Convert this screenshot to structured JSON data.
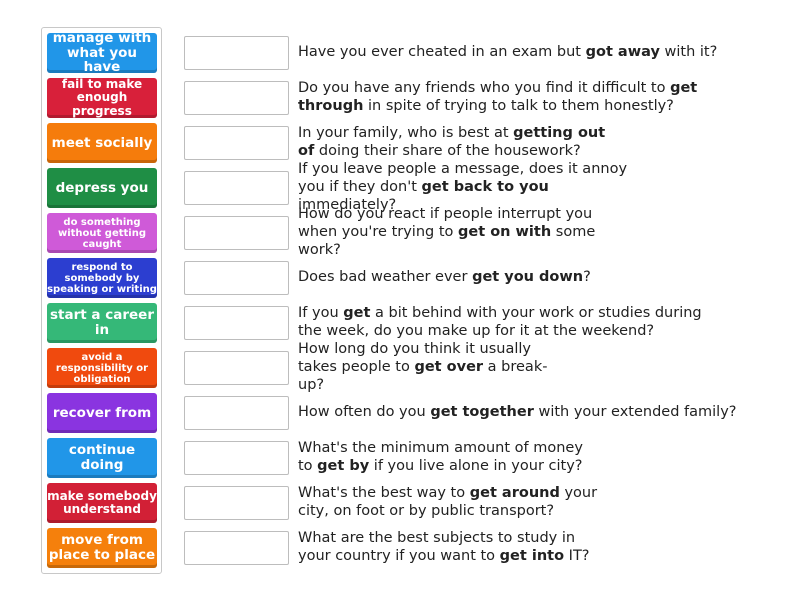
{
  "tiles": [
    {
      "label": "manage with what you have",
      "color": "#2196e8",
      "size": "s14"
    },
    {
      "label": "fail to make enough progress",
      "color": "#d8203a",
      "size": "s12"
    },
    {
      "label": "meet socially",
      "color": "#f57c0c",
      "size": "s14"
    },
    {
      "label": "depress you",
      "color": "#1f8e45",
      "size": "s14"
    },
    {
      "label": "do something without getting caught",
      "color": "#cf5ad8",
      "size": "s10"
    },
    {
      "label": "respond to somebody by speaking or writing",
      "color": "#2c3ed0",
      "size": "s10"
    },
    {
      "label": "start a career in",
      "color": "#35b878",
      "size": "s14"
    },
    {
      "label": "avoid a responsibility or obligation",
      "color": "#f04a0e",
      "size": "s10"
    },
    {
      "label": "recover from",
      "color": "#8a34e0",
      "size": "s14"
    },
    {
      "label": "continue doing",
      "color": "#2196e8",
      "size": "s14"
    },
    {
      "label": "make somebody understand",
      "color": "#d22036",
      "size": "s12"
    },
    {
      "label": "move from place to place",
      "color": "#f5800c",
      "size": "s14"
    }
  ],
  "questions": [
    {
      "pre": "Have you ever cheated in an exam but ",
      "bold": "got away",
      "post": " with it?"
    },
    {
      "pre": "Do you have any friends who you find it difficult to ",
      "bold": "get through",
      "post": " in spite of trying to talk to them honestly?"
    },
    {
      "pre": "In your family, who is best at ",
      "bold": "getting out of",
      "post": " doing their share of the housework?"
    },
    {
      "pre": "If you leave people a message, does it annoy you if they don't ",
      "bold": "get back to you",
      "post": " immediately?"
    },
    {
      "pre": "How do you react if people interrupt you when you're trying to ",
      "bold": "get on with",
      "post": " some work?"
    },
    {
      "pre": "Does bad weather ever ",
      "bold": "get you down",
      "post": "?"
    },
    {
      "pre": "If you ",
      "bold": "get",
      "post": " a bit behind with your work or studies during the week, do you make up for it at the weekend?"
    },
    {
      "pre": "How long do you think it usually takes people to ",
      "bold": "get over",
      "post": " a break-up?"
    },
    {
      "pre": "How often do you ",
      "bold": "get together",
      "post": " with your extended family?"
    },
    {
      "pre": "What's the minimum amount of money to ",
      "bold": "get by",
      "post": " if you live alone in your city?"
    },
    {
      "pre": "What's the best way to ",
      "bold": "get around",
      "post": " your city, on foot or by public transport?"
    },
    {
      "pre": "What are the best subjects to study in your country if you want to ",
      "bold": "get into",
      "post": " IT?"
    }
  ]
}
